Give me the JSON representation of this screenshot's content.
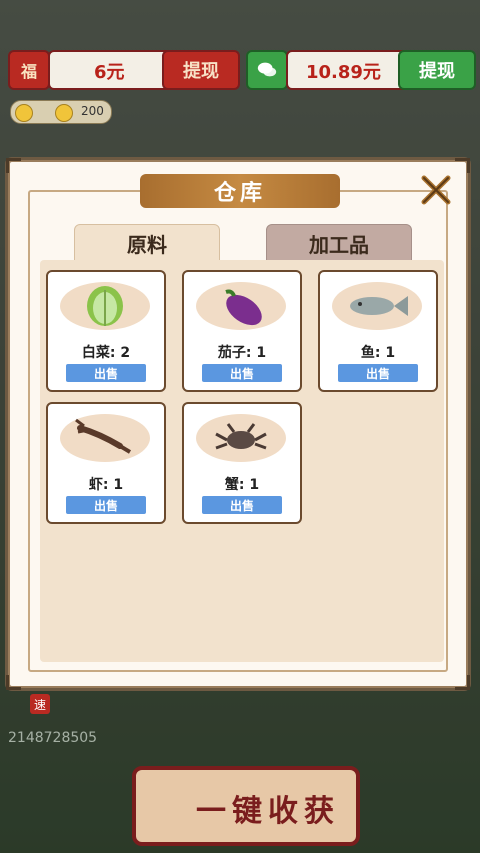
{
  "topbar": {
    "fu_label": "福",
    "fu_amount": "6元",
    "withdraw_left": "提现",
    "wechat_amount": "10.89元",
    "withdraw_right": "提现"
  },
  "coins": {
    "count": "200"
  },
  "modal": {
    "title": "仓库",
    "tabs": [
      {
        "label": "原料"
      },
      {
        "label": "加工品"
      }
    ],
    "items": [
      {
        "name": "白菜: 2",
        "icon": "cabbage-icon",
        "button": "出售"
      },
      {
        "name": "茄子: 1",
        "icon": "eggplant-icon",
        "button": "出售"
      },
      {
        "name": "鱼: 1",
        "icon": "fish-icon",
        "button": "出售"
      },
      {
        "name": "虾: 1",
        "icon": "crayfish-icon",
        "button": "出售"
      },
      {
        "name": "蟹: 1",
        "icon": "crab-icon",
        "button": "出售"
      }
    ]
  },
  "bottom": {
    "speed_label": "速",
    "id_text": "2148728505",
    "harvest_label": "一键收获"
  },
  "colors": {
    "accent_red": "#b92a22",
    "accent_green": "#3aa247",
    "sell_blue": "#5b97e0",
    "banner_gold": "#c58a42"
  }
}
